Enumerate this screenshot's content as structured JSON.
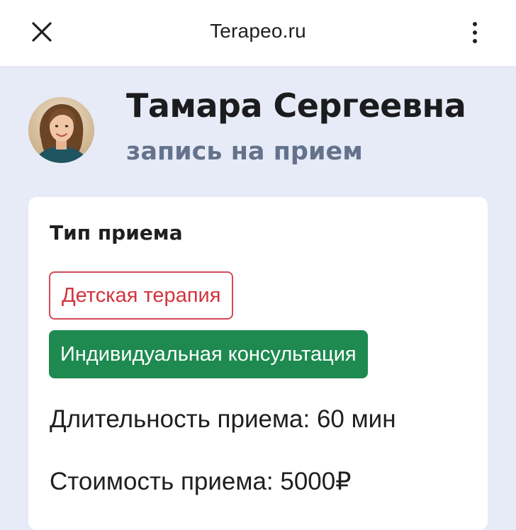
{
  "header": {
    "site_title": "Terapeo.ru",
    "close_icon": "close-icon",
    "menu_icon": "more-vertical-icon"
  },
  "profile": {
    "name": "Тамара Сергеевна",
    "subtitle": "запись на прием",
    "avatar_icon": "avatar-photo"
  },
  "booking": {
    "section_title": "Тип приема",
    "options": [
      {
        "label": "Детская терапия",
        "selected": false
      },
      {
        "label": "Индивидуальная консультация",
        "selected": true
      }
    ],
    "duration_text": "Длительность приема: 60 мин",
    "price_text": "Стоимость приема: 5000₽"
  },
  "colors": {
    "page_background": "#e7ebf7",
    "option_unselected": "#d2343e",
    "option_selected": "#1e8a50",
    "subtitle": "#64728c"
  }
}
